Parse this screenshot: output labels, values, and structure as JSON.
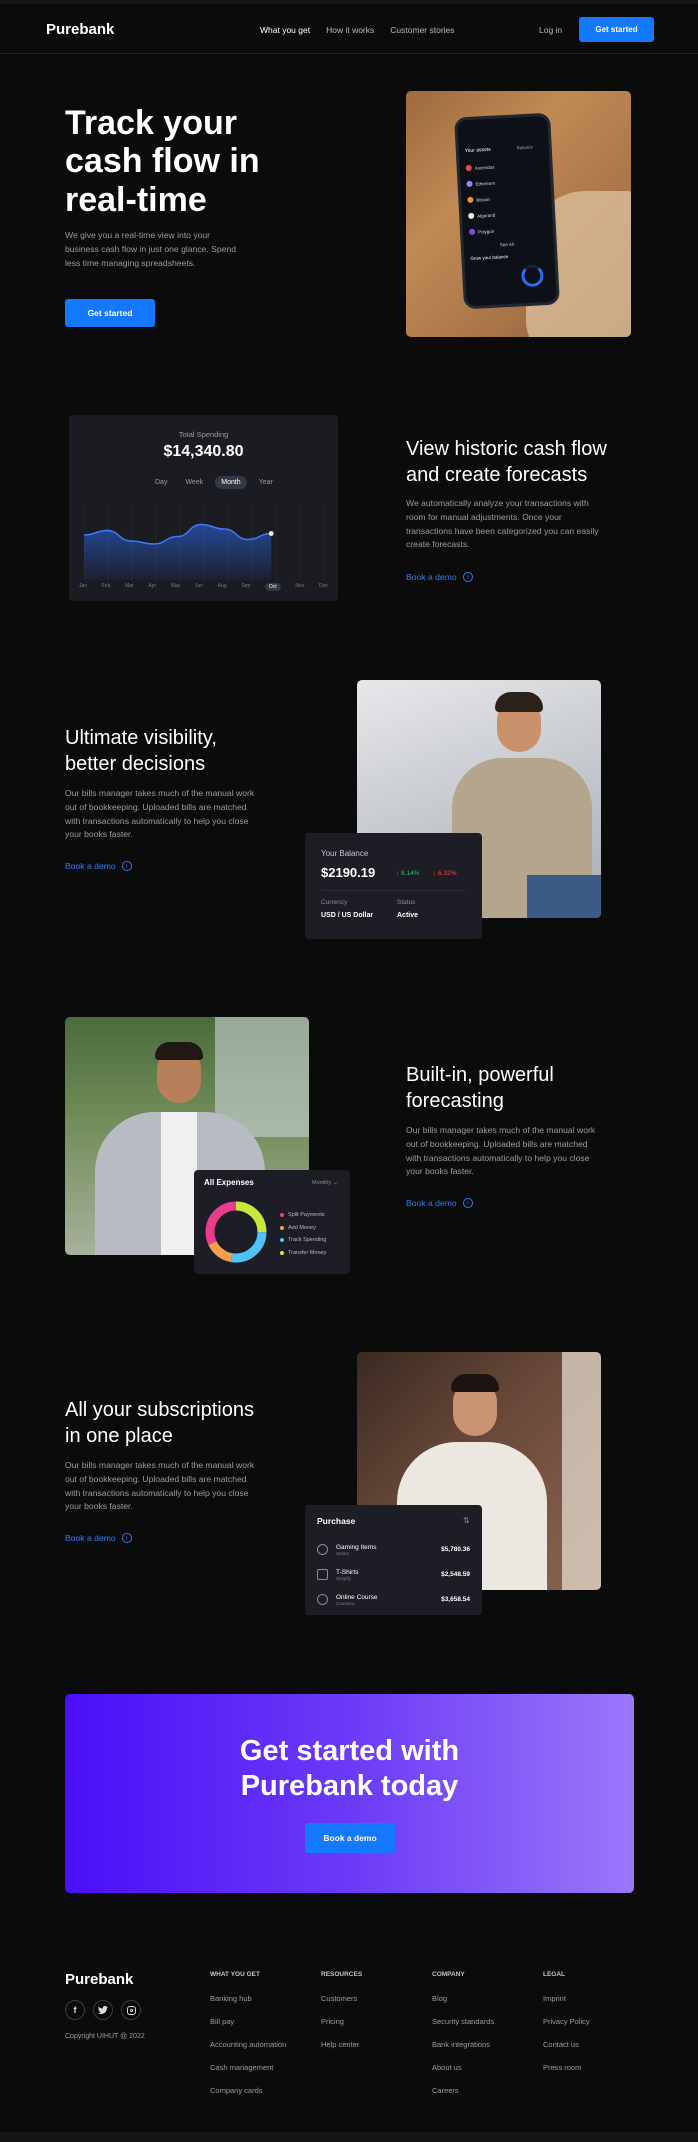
{
  "header": {
    "logo": "Purebank",
    "nav": [
      "What you get",
      "How it works",
      "Customer stories"
    ],
    "login": "Log in",
    "cta": "Get started"
  },
  "hero": {
    "title_lines": [
      "Track your",
      "cash flow in",
      "real-time"
    ],
    "body": "We give you a real-time view into your business cash flow in just one glance. Spend less time managing spreadsheets.",
    "cta": "Get started",
    "phone": {
      "section_title": "Your assets",
      "balance_label": "Balance",
      "assets": [
        {
          "name": "Ascendos"
        },
        {
          "name": "Ethereum"
        },
        {
          "name": "Bitcoin"
        },
        {
          "name": "Algorand"
        },
        {
          "name": "Polygon"
        }
      ],
      "see_all": "See All",
      "grow_label": "Grow your balance"
    }
  },
  "section_forecast": {
    "title_lines": [
      "View historic cash flow",
      "and create forecasts"
    ],
    "body": "We automatically analyze your transactions with room for manual adjustments. Once your transactions have been categorized you can easily create forecasts.",
    "link": "Book a demo",
    "spending_card": {
      "label": "Total Spending",
      "amount": "$14,340.80",
      "periods": [
        "Day",
        "Week",
        "Month",
        "Year"
      ],
      "selected_period": "Month",
      "months": [
        "Jan",
        "Feb",
        "Mar",
        "Apr",
        "May",
        "Jun",
        "Aug",
        "Sep",
        "Oct",
        "Nov",
        "Dec"
      ],
      "selected_month": "Oct"
    }
  },
  "chart_data": {
    "type": "area",
    "title": "Total Spending",
    "categories": [
      "Jan",
      "Feb",
      "Mar",
      "Apr",
      "May",
      "Jun",
      "Aug",
      "Sep",
      "Oct",
      "Nov",
      "Dec"
    ],
    "series": [
      {
        "values": [
          60,
          66,
          52,
          48,
          58,
          74,
          68,
          54,
          62
        ]
      }
    ],
    "ylim": [
      0,
      100
    ],
    "grid": true
  },
  "section_visibility": {
    "title_lines": [
      "Ultimate visibility,",
      "better decisions"
    ],
    "body": "Our bills manager takes much of the manual work out of bookkeeping. Uploaded bills are matched with transactions automatically to help you close your books faster.",
    "link": "Book a demo",
    "balance_card": {
      "label": "Your Balance",
      "amount": "$2190.19",
      "up": "↑ 8.14%",
      "down": "↓ 6.32%",
      "currency_label": "Currency",
      "currency_value": "USD / US Dollar",
      "status_label": "Status",
      "status_value": "Active"
    }
  },
  "section_builtin": {
    "title_lines": [
      "Built-in, powerful",
      "forecasting"
    ],
    "body": "Our bills manager takes much of the manual work out of bookkeeping. Uploaded bills are matched with transactions automatically to help you close your books faster.",
    "link": "Book a demo",
    "expenses_card": {
      "title": "All Expenses",
      "period": "Monthly",
      "legend": [
        {
          "label": "Split Payments",
          "color": "#e83d8c"
        },
        {
          "label": "Add Money",
          "color": "#f6a04d"
        },
        {
          "label": "Track Spending",
          "color": "#4fc3f7"
        },
        {
          "label": "Transfer Money",
          "color": "#c6e93f"
        }
      ]
    }
  },
  "section_subscriptions": {
    "title_lines": [
      "All your subscriptions",
      "in one place"
    ],
    "body": "Our bills manager takes much of the manual work out of bookkeeping. Uploaded bills are matched with transactions automatically to help you close your books faster.",
    "link": "Book a demo",
    "purchase_card": {
      "title": "Purchase",
      "items": [
        {
          "name": "Gaming Items",
          "sub": "Steam",
          "amount": "$5,780.36"
        },
        {
          "name": "T-Shirts",
          "sub": "Shopify",
          "amount": "$2,548.59"
        },
        {
          "name": "Online Course",
          "sub": "Coursera",
          "amount": "$3,658.54"
        }
      ]
    }
  },
  "cta_banner": {
    "title_lines": [
      "Get started with",
      "Purebank today"
    ],
    "button": "Book a demo"
  },
  "footer": {
    "logo": "Purebank",
    "copyright": "Copyright UIHUT @ 2022",
    "columns": [
      {
        "heading": "WHAT YOU GET",
        "links": [
          "Banking hub",
          "Bill pay",
          "Accounting automation",
          "Cash management",
          "Company cards"
        ]
      },
      {
        "heading": "RESOURCES",
        "links": [
          "Customers",
          "Pricing",
          "Help center"
        ]
      },
      {
        "heading": "COMPANY",
        "links": [
          "Blog",
          "Security standards",
          "Bank integrations",
          "About us",
          "Careers"
        ]
      },
      {
        "heading": "LEGAL",
        "links": [
          "Imprint",
          "Privacy Policy",
          "Contact us",
          "Press room"
        ]
      }
    ]
  }
}
